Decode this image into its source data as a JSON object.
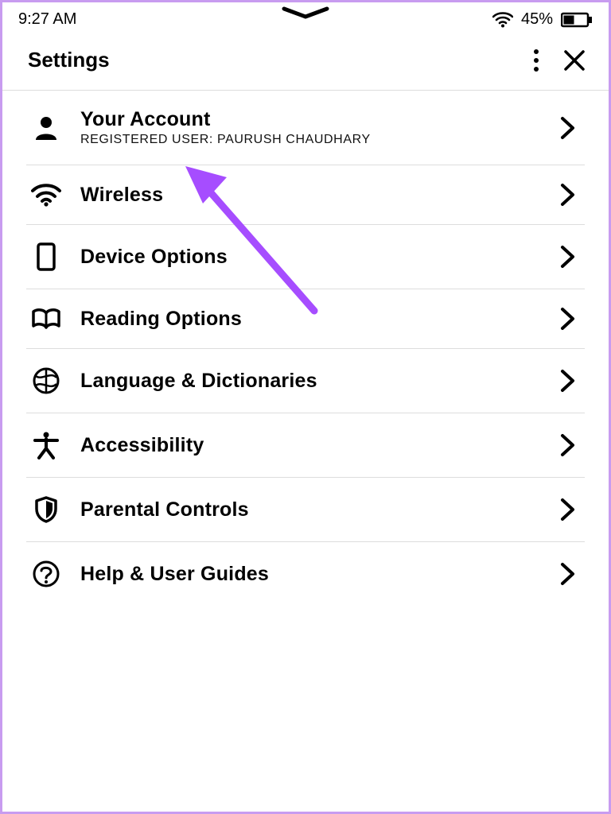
{
  "statusbar": {
    "time": "9:27 AM",
    "battery_text": "45%"
  },
  "header": {
    "title": "Settings"
  },
  "items": [
    {
      "key": "account",
      "title": "Your Account",
      "sub": "REGISTERED USER: PAURUSH CHAUDHARY"
    },
    {
      "key": "wireless",
      "title": "Wireless",
      "sub": ""
    },
    {
      "key": "device",
      "title": "Device Options",
      "sub": ""
    },
    {
      "key": "reading",
      "title": "Reading Options",
      "sub": ""
    },
    {
      "key": "language",
      "title": "Language & Dictionaries",
      "sub": ""
    },
    {
      "key": "accessibility",
      "title": "Accessibility",
      "sub": ""
    },
    {
      "key": "parental",
      "title": "Parental Controls",
      "sub": ""
    },
    {
      "key": "help",
      "title": "Help & User Guides",
      "sub": ""
    }
  ]
}
